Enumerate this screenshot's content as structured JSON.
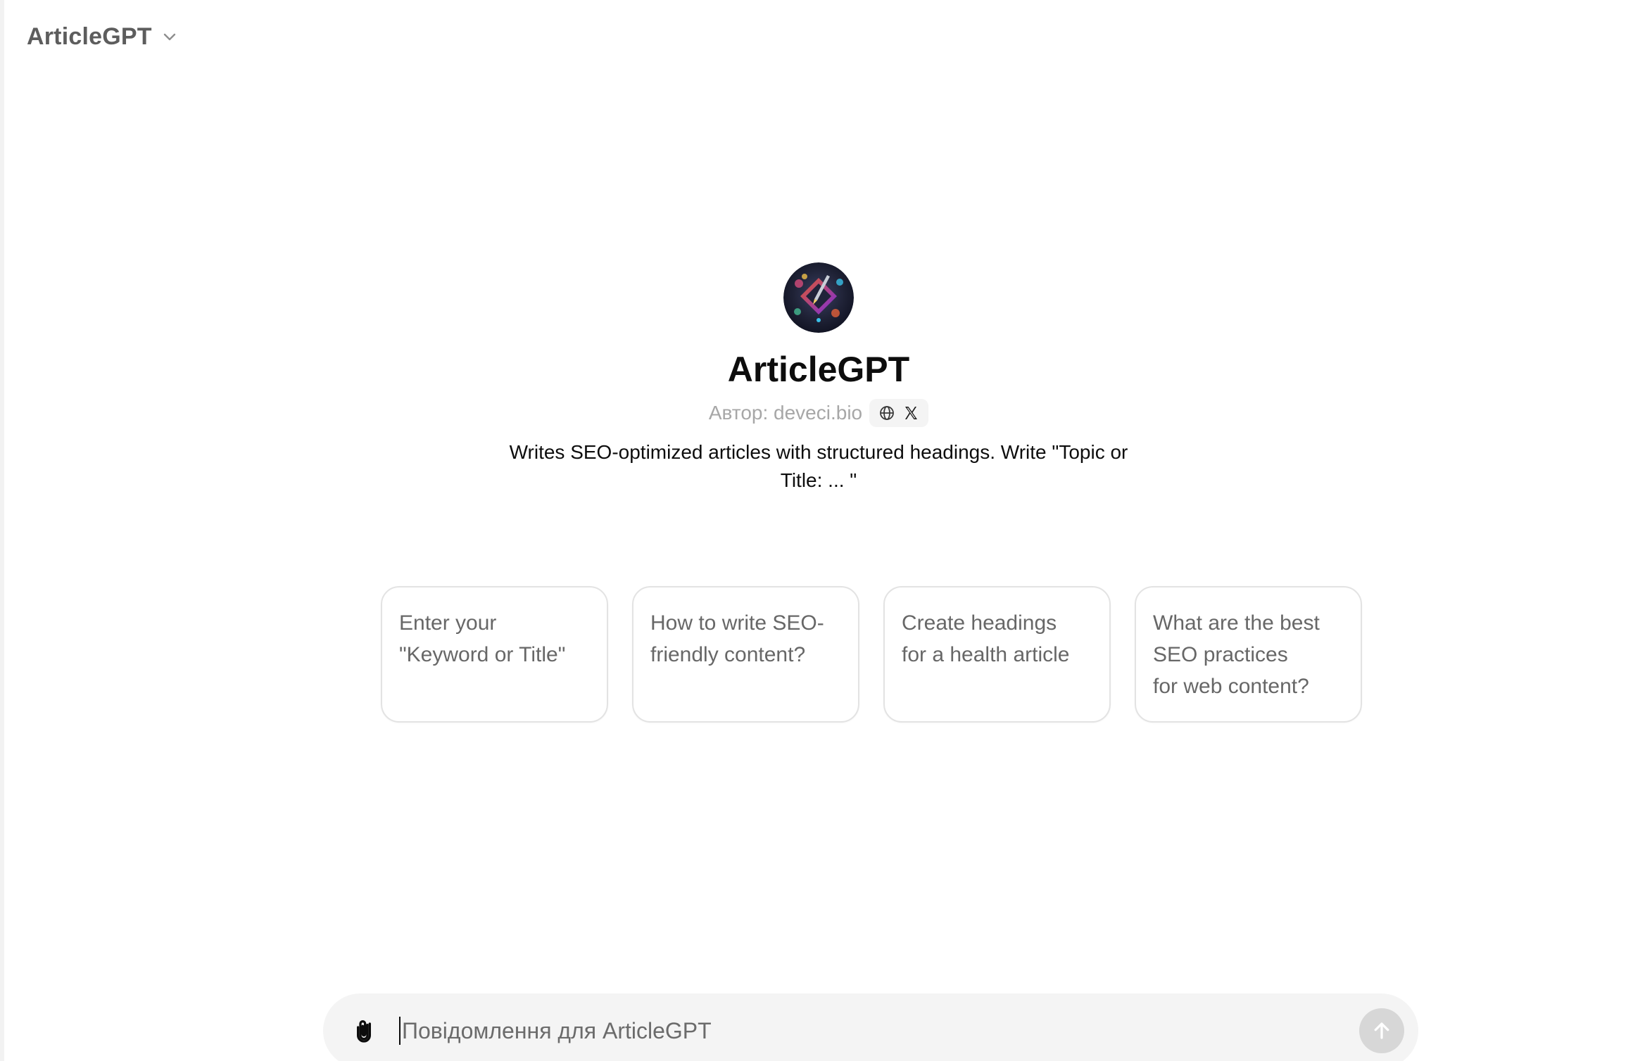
{
  "header": {
    "model_name": "ArticleGPT",
    "chevron_icon": "chevron-down-icon"
  },
  "gpt": {
    "avatar_icon": "gpt-avatar-image",
    "name": "ArticleGPT",
    "author": "Автор: deveci.bio",
    "links": [
      "globe-icon",
      "x-logo-icon"
    ],
    "description": "Writes SEO-optimized articles with structured headings. Write \"Topic or Title: ... \""
  },
  "suggestions": [
    {
      "lines": [
        "Enter your",
        "\"Keyword or Title\""
      ]
    },
    {
      "lines": [
        "How to write SEO-",
        "friendly content?"
      ]
    },
    {
      "lines": [
        "Create headings",
        "for a health article"
      ]
    },
    {
      "lines": [
        "What are the best",
        "SEO practices",
        "for web content?"
      ]
    }
  ],
  "composer": {
    "placeholder": "Повідомлення для ArticleGPT",
    "value": "",
    "attach_icon": "paperclip-icon",
    "send_icon": "arrow-up-icon"
  },
  "colors": {
    "muted_text": "#a7a7a7",
    "card_border": "#e3e3e3",
    "composer_bg": "#f4f4f4",
    "send_disabled": "#d7d7d7"
  }
}
